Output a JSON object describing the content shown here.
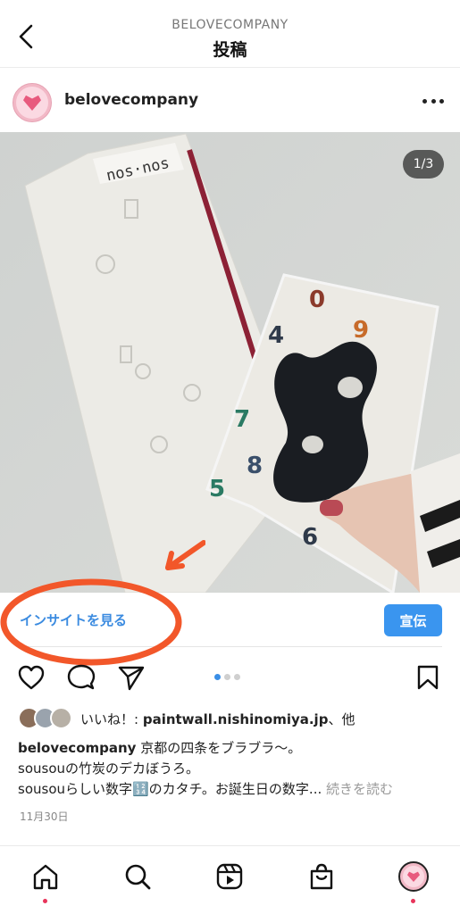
{
  "header": {
    "account": "BELOVECOMPANY",
    "title": "投稿",
    "back_icon": "chevron-left-icon"
  },
  "post": {
    "username": "belovecompany",
    "more_icon": "ellipsis-icon",
    "image_counter": "1/3",
    "photo_label": "nos·nos",
    "carousel": {
      "total": 3,
      "active": 1
    }
  },
  "insights": {
    "link_label": "インサイトを見る",
    "ad_button_label": "宣伝"
  },
  "actions": {
    "like_icon": "heart-icon",
    "comment_icon": "comment-icon",
    "share_icon": "send-icon",
    "save_icon": "bookmark-icon"
  },
  "likes": {
    "prefix": "いいね！: ",
    "liker": "paintwall.nishinomiya.jp",
    "suffix": "、他"
  },
  "caption": {
    "username": "belovecompany",
    "line1": " 京都の四条をブラブラ〜。",
    "line2": "sousouの竹炭のデカぼうろ。",
    "line3": "sousouらしい数字🔢のカタチ。お誕生日の数字...",
    "more_label": " 続きを読む"
  },
  "date": "11月30日",
  "bottom_nav": {
    "items": [
      "home-icon",
      "search-icon",
      "reels-icon",
      "shop-icon",
      "profile-avatar"
    ]
  },
  "colors": {
    "accent_blue": "#3a95ef",
    "link_blue": "#3b8be0",
    "annotation_orange": "#f2572a",
    "notification_dot": "#e8345b"
  }
}
